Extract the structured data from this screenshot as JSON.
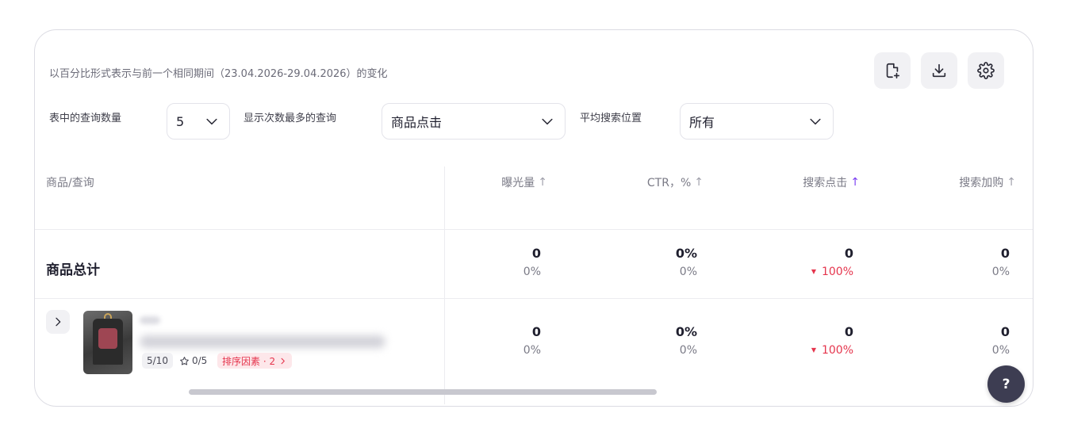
{
  "header": {
    "period_note": "以百分比形式表示与前一个相同期间（23.04.2026-29.04.2026）的变化",
    "toolbar": [
      {
        "icon": "file-add-icon"
      },
      {
        "icon": "download-icon"
      },
      {
        "icon": "gear-icon"
      }
    ]
  },
  "filters": {
    "query_count": {
      "label": "表中的查询数量",
      "value": "5"
    },
    "top_queries": {
      "label": "显示次数最多的查询",
      "value": "商品点击"
    },
    "avg_position": {
      "label": "平均搜索位置",
      "value": "所有"
    }
  },
  "table": {
    "columns": [
      {
        "label": "商品/查询"
      },
      {
        "label": "曝光量",
        "arrow": "↑"
      },
      {
        "label": "CTR，%",
        "arrow": "↑"
      },
      {
        "label": "搜索点击",
        "arrow": "↑",
        "active": true
      },
      {
        "label": "搜索加购",
        "arrow": "↑"
      }
    ],
    "total_row": {
      "title": "商品总计",
      "metrics": [
        {
          "value": "0",
          "change": "0%"
        },
        {
          "value": "0%",
          "change": "0%"
        },
        {
          "value": "0",
          "change": "100%",
          "negative": true
        },
        {
          "value": "0",
          "change": "0%"
        }
      ]
    },
    "product_row": {
      "count_chip": "5/10",
      "stars_chip": "0/5",
      "factors_chip": "排序因素 · 2",
      "metrics": [
        {
          "value": "0",
          "change": "0%"
        },
        {
          "value": "0%",
          "change": "0%"
        },
        {
          "value": "0",
          "change": "100%",
          "negative": true
        },
        {
          "value": "0",
          "change": "0%"
        }
      ]
    }
  },
  "help_button": {
    "label": "?"
  },
  "colors": {
    "accent": "#7b3ff2",
    "negative": "#e5354d",
    "border": "#dcdce3"
  }
}
